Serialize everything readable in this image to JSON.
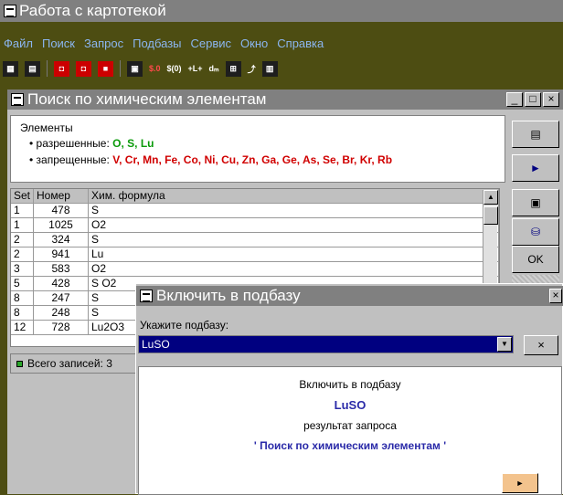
{
  "app": {
    "title": "Работа с картотекой"
  },
  "menu": [
    "Файл",
    "Поиск",
    "Запрос",
    "Подбазы",
    "Сервис",
    "Окно",
    "Справка"
  ],
  "toolbar": {
    "text_buttons": [
      "$.0",
      "$(0)",
      "+L+",
      "dₘ"
    ]
  },
  "search_window": {
    "title": "Поиск по химическим элементам",
    "controls": {
      "minimize": "_",
      "maximize": "□",
      "close": "×"
    },
    "elements_title": "Элементы",
    "allowed_label": "• разрешенные:",
    "allowed_value": "O, S, Lu",
    "forbidden_label": "• запрещенные:",
    "forbidden_value": "V, Cr, Mn, Fe, Co, Ni, Cu, Zn, Ga, Ge, As, Se, Br, Kr, Rb",
    "table": {
      "headers": [
        "Set",
        "Номер",
        "Хим. формула"
      ],
      "rows": [
        [
          "1",
          "478",
          "S"
        ],
        [
          "1",
          "1025",
          "O2"
        ],
        [
          "2",
          "324",
          "S"
        ],
        [
          "2",
          "941",
          "Lu"
        ],
        [
          "3",
          "583",
          "O2"
        ],
        [
          "5",
          "428",
          "S O2"
        ],
        [
          "8",
          "247",
          "S"
        ],
        [
          "8",
          "248",
          "S"
        ],
        [
          "12",
          "728",
          "Lu2O3"
        ]
      ]
    },
    "status": "Всего записей: 3",
    "side_buttons": {
      "ok": "OK",
      "next": "►"
    }
  },
  "dialog": {
    "title": "Включить в подбазу",
    "prompt": "Укажите подбазу:",
    "selected_subbase": "LuSO",
    "clear_label": "×",
    "body_line1": "Включить в подбазу",
    "body_subbase": "LuSO",
    "body_line2": "результат запроса",
    "body_query": "' Поиск по химическим элементам '",
    "go_label": "►"
  }
}
